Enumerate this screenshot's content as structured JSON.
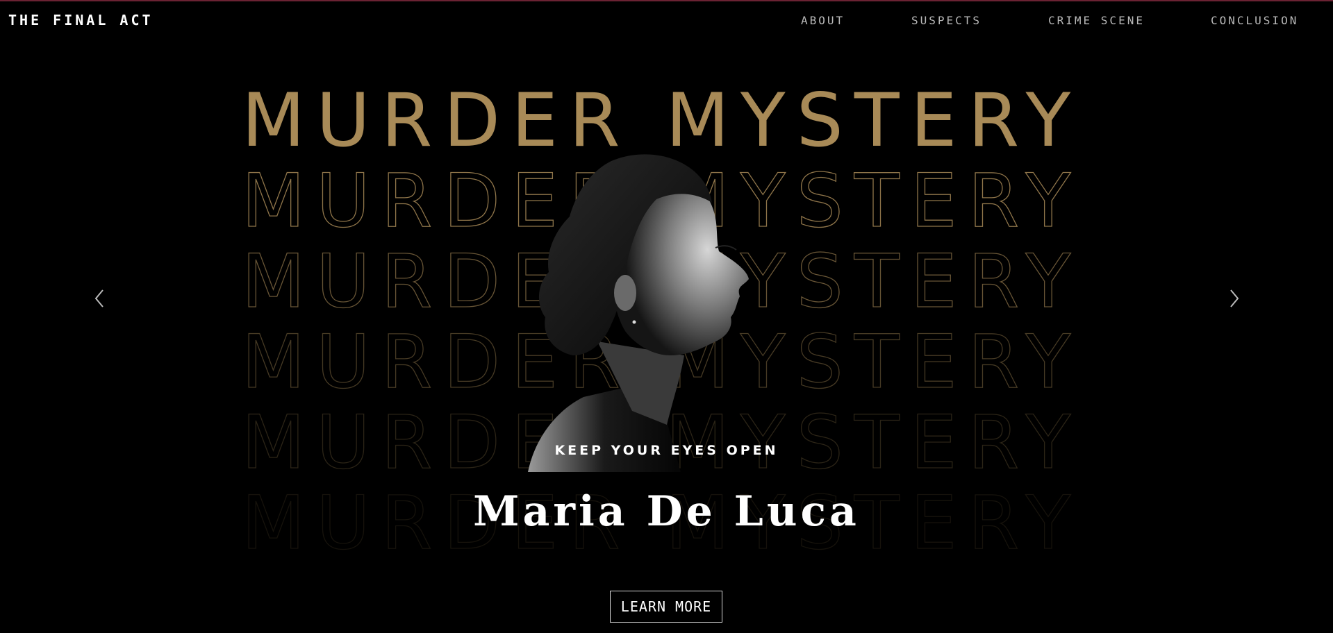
{
  "brand": "THE FINAL ACT",
  "nav": {
    "items": [
      "ABOUT",
      "SUSPECTS",
      "CRIME SCENE",
      "CONCLUSION"
    ]
  },
  "hero": {
    "title": "MURDER MYSTERY",
    "tagline": "KEEP YOUR EYES OPEN",
    "name": "Maria De Luca",
    "button_label": "LEARN MORE"
  },
  "colors": {
    "background": "#000000",
    "accent_gold": "#a88a57",
    "top_line": "#6b2233",
    "text": "#ffffff",
    "nav_text": "#b9b9b9"
  },
  "icons": {
    "prev": "chevron-left-icon",
    "next": "chevron-right-icon"
  }
}
